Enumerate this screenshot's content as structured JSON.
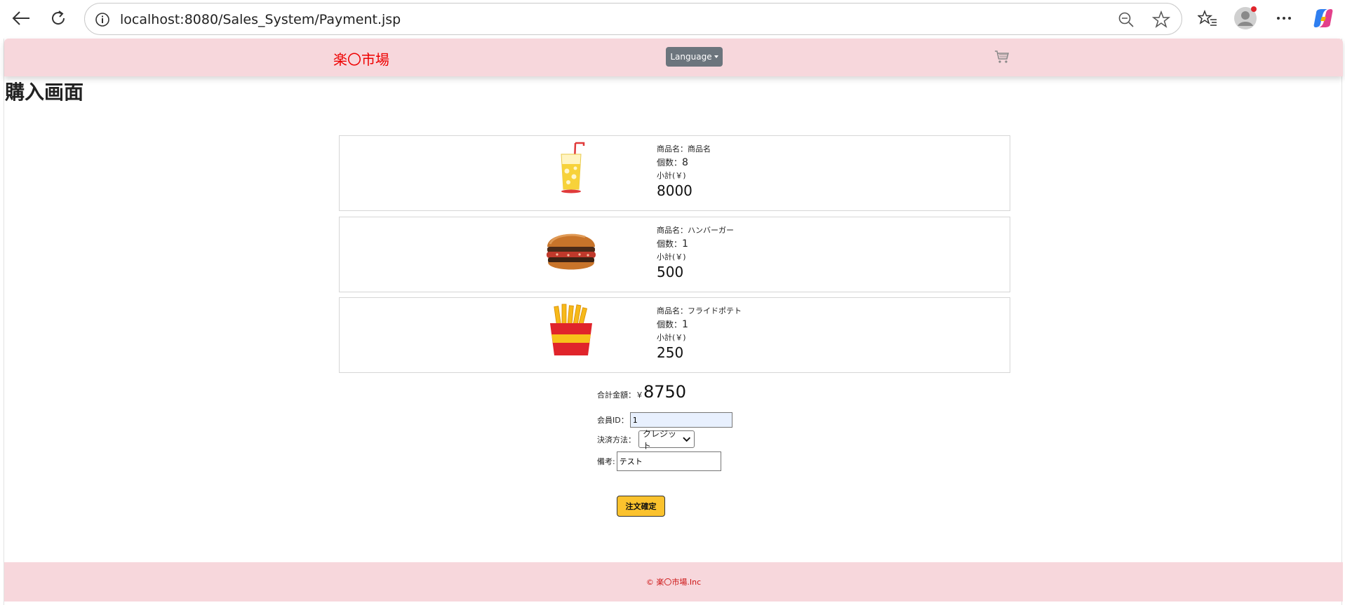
{
  "browser": {
    "url": "localhost:8080/Sales_System/Payment.jsp"
  },
  "header": {
    "brand": "楽〇市場",
    "language_label": "Language",
    "cart_icon": "cart-icon"
  },
  "page_title": "購入画面",
  "items": [
    {
      "name_label": "商品名：",
      "name": "商品名",
      "qty_label": "個数：",
      "qty": "8",
      "subtotal_label": "小計(￥)",
      "subtotal": "8000",
      "icon": "juice-icon"
    },
    {
      "name_label": "商品名：",
      "name": "ハンバーガー",
      "qty_label": "個数：",
      "qty": "1",
      "subtotal_label": "小計(￥)",
      "subtotal": "500",
      "icon": "hamburger-icon"
    },
    {
      "name_label": "商品名：",
      "name": "フライドポテト",
      "qty_label": "個数：",
      "qty": "1",
      "subtotal_label": "小計(￥)",
      "subtotal": "250",
      "icon": "fries-icon"
    }
  ],
  "summary": {
    "total_label": "合計金額：￥",
    "total": "8750",
    "member_label": "会員ID：",
    "member_value": "1",
    "payment_label": "決済方法：",
    "payment_selected": "クレジット",
    "note_label": "備考:",
    "note_value": "テスト",
    "order_button": "注文確定"
  },
  "footer": {
    "copyright": "© 楽〇市場.Inc"
  },
  "colors": {
    "nav_bg": "#f7d7dc",
    "brand": "#ee0000",
    "order_button": "#fbc22d"
  }
}
